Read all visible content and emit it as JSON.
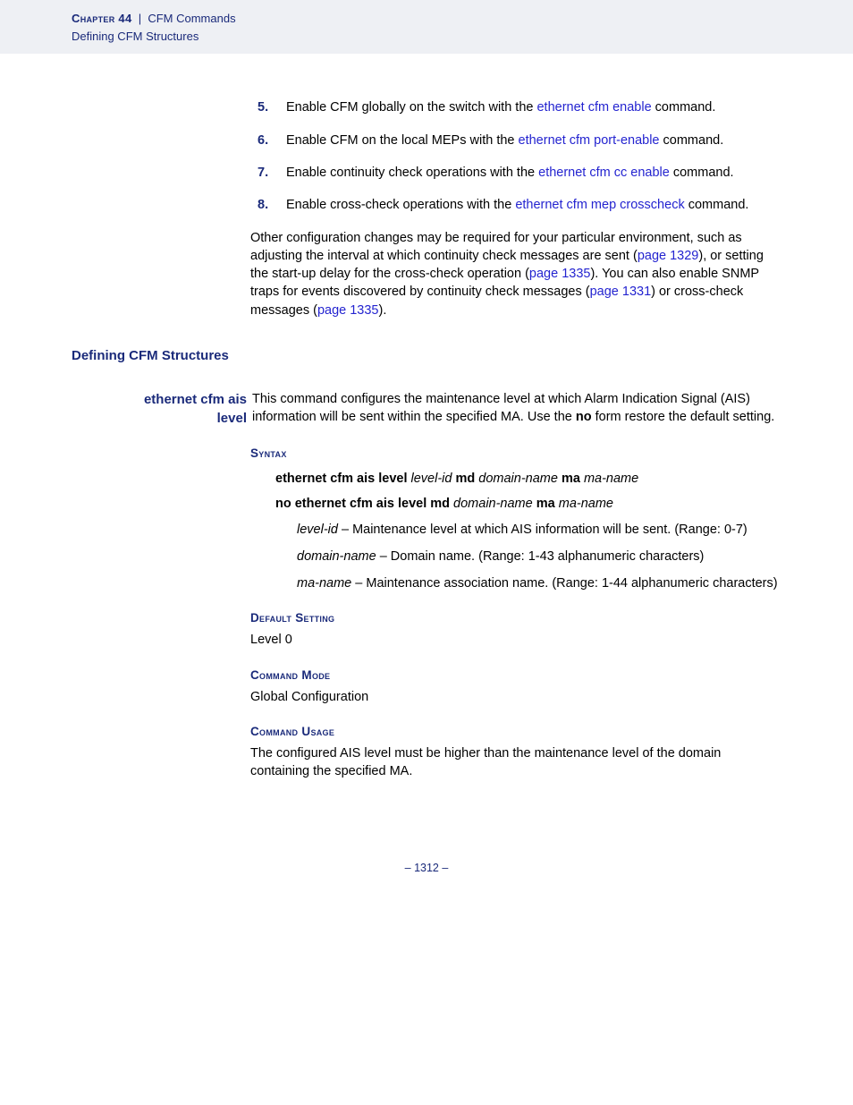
{
  "header": {
    "chapter_word": "Chapter",
    "chapter_num": "44",
    "divider": "|",
    "chapter_title": "CFM Commands",
    "subhead": "Defining CFM Structures"
  },
  "steps": [
    {
      "n": "5.",
      "pre": "Enable CFM globally on the switch with the ",
      "link": "ethernet cfm enable",
      "post": " command."
    },
    {
      "n": "6.",
      "pre": "Enable CFM on the local MEPs with the ",
      "link": "ethernet cfm port-enable",
      "post": " command."
    },
    {
      "n": "7.",
      "pre": "Enable continuity check operations with the ",
      "link": "ethernet cfm cc enable",
      "post": " command."
    },
    {
      "n": "8.",
      "pre": "Enable cross-check operations with the ",
      "link": "ethernet cfm mep crosscheck",
      "post": " command."
    }
  ],
  "other_config": {
    "t1": "Other configuration changes may be required for your particular environment, such as adjusting the interval at which continuity check messages are sent (",
    "l1": "page 1329",
    "t2": "), or setting the start-up delay for the cross-check operation (",
    "l2": "page 1335",
    "t3": "). You can also enable SNMP traps for events discovered by continuity check messages (",
    "l3": "page 1331",
    "t4": ") or cross-check messages (",
    "l4": "page 1335",
    "t5": ")."
  },
  "section_title": "Defining CFM Structures",
  "command": {
    "name_line1": "ethernet cfm ais",
    "name_line2": "level",
    "desc_pre": "This command configures the maintenance level at which Alarm Indication Signal (AIS) information will be sent within the specified MA. Use the ",
    "desc_bold": "no",
    "desc_post": " form restore the default setting."
  },
  "syntax_heading": "Syntax",
  "syntax": {
    "line1": {
      "b1": "ethernet cfm ais level ",
      "i1": "level-id",
      "b2": " md ",
      "i2": "domain-name",
      "b3": " ma ",
      "i3": "ma-name"
    },
    "line2": {
      "b1": "no ethernet cfm ais level md ",
      "i1": "domain-name",
      "b2": " ma ",
      "i2": "ma-name"
    },
    "params": [
      {
        "name": "level-id",
        "sep": " – ",
        "desc": "Maintenance level at which AIS information will be sent. (Range: 0-7)"
      },
      {
        "name": "domain-name",
        "sep": " – ",
        "desc": "Domain name. (Range: 1-43 alphanumeric characters)"
      },
      {
        "name": "ma-name",
        "sep": " – ",
        "desc": "Maintenance association name. (Range: 1-44 alphanumeric characters)"
      }
    ]
  },
  "default_heading": "Default Setting",
  "default_value": "Level 0",
  "mode_heading": "Command Mode",
  "mode_value": "Global Configuration",
  "usage_heading": "Command Usage",
  "usage_text": "The configured AIS level must be higher than the maintenance level of the domain containing the specified MA.",
  "footer": "–  1312  –"
}
